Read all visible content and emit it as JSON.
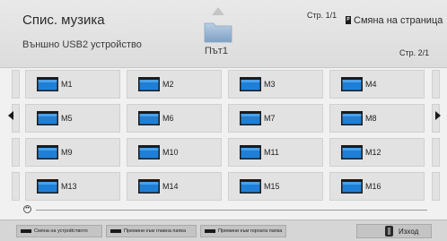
{
  "header": {
    "title": "Спис. музика",
    "device": "Външно USB2 устройство",
    "path_label": "Път1",
    "page_top": "Стр. 1/1",
    "change_page": "Смяна на страница",
    "change_page_icon": "P",
    "page_right": "Стр. 2/1"
  },
  "folders": [
    "M1",
    "M2",
    "M3",
    "M4",
    "M5",
    "M6",
    "M7",
    "M8",
    "M9",
    "M10",
    "M11",
    "M12",
    "M13",
    "M14",
    "M15",
    "M16"
  ],
  "footer": {
    "buttons": [
      "Смяна на устройството",
      "Премини към главна папка",
      "Премини към горната папка"
    ],
    "exit": "Изход"
  },
  "colors": {
    "folder_blue": "#1f7fd6",
    "folder_dark": "#1b1b1b",
    "tile_bg": "#e2e2e2"
  }
}
